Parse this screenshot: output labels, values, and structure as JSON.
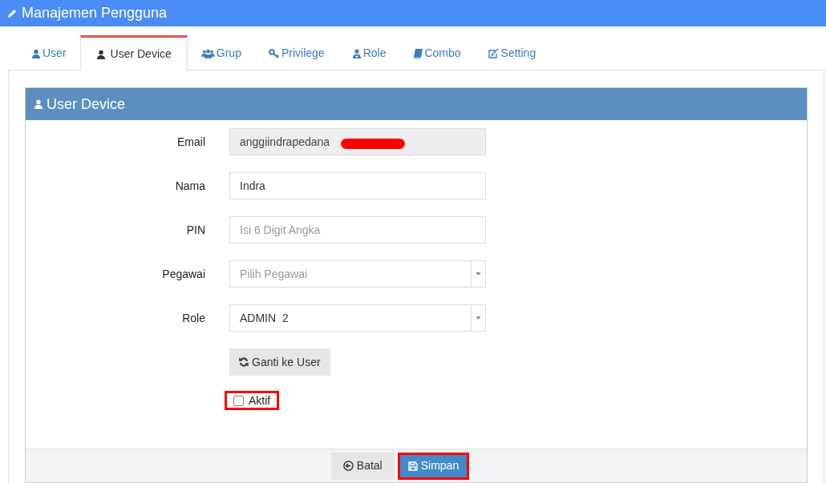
{
  "page_title": "Manajemen Pengguna",
  "tabs": [
    {
      "label": "User",
      "kind": "user",
      "selected": false
    },
    {
      "label": "User Device",
      "kind": "user",
      "selected": true
    },
    {
      "label": "Grup",
      "kind": "users",
      "selected": false
    },
    {
      "label": "Privilege",
      "kind": "key",
      "selected": false
    },
    {
      "label": "Role",
      "kind": "role",
      "selected": false
    },
    {
      "label": "Combo",
      "kind": "book",
      "selected": false
    },
    {
      "label": "Setting",
      "kind": "edit",
      "selected": false
    }
  ],
  "panel": {
    "title": "User Device",
    "fields": [
      {
        "label": "Email",
        "kind": "readonly",
        "value": "anggiindrapedana",
        "redacted": true
      },
      {
        "label": "Nama",
        "kind": "text",
        "value": "Indra"
      },
      {
        "label": "PIN",
        "kind": "text",
        "placeholder": "Isi 6 Digit Angka"
      },
      {
        "label": "Pegawai",
        "kind": "select",
        "placeholder": "Pilih Pegawai"
      },
      {
        "label": "Role",
        "kind": "select",
        "value": "ADMIN  2"
      }
    ],
    "switch_button": "Ganti ke User",
    "active_checkbox": {
      "label": "Aktif",
      "checked": false,
      "highlighted": true
    },
    "footer_buttons": [
      {
        "label": "Batal",
        "kind": "cancel",
        "highlighted": false
      },
      {
        "label": "Simpan",
        "kind": "save",
        "highlighted": true
      }
    ]
  }
}
